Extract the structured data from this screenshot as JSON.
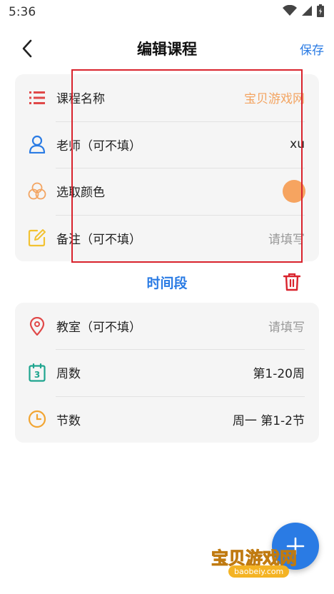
{
  "status_bar": {
    "time": "5:36"
  },
  "header": {
    "title": "编辑课程",
    "save_label": "保存"
  },
  "course_card": {
    "name": {
      "label": "课程名称",
      "value": "宝贝游戏网"
    },
    "teacher": {
      "label": "老师（可不填）",
      "value": "xu"
    },
    "color": {
      "label": "选取颜色",
      "color": "#f6a460"
    },
    "note": {
      "label": "备注（可不填）",
      "placeholder": "请填写"
    }
  },
  "time_section": {
    "title": "时间段"
  },
  "time_card": {
    "classroom": {
      "label": "教室（可不填）",
      "placeholder": "请填写"
    },
    "weeks": {
      "label": "周数",
      "value": "第1-20周"
    },
    "periods": {
      "label": "节数",
      "value": "周一 第1-2节"
    }
  },
  "watermark": {
    "text": "宝贝游戏网",
    "sub": "baobeiy.com"
  },
  "colors": {
    "accent": "#2a7be4",
    "danger": "#d9232d",
    "orange": "#f3a461"
  }
}
